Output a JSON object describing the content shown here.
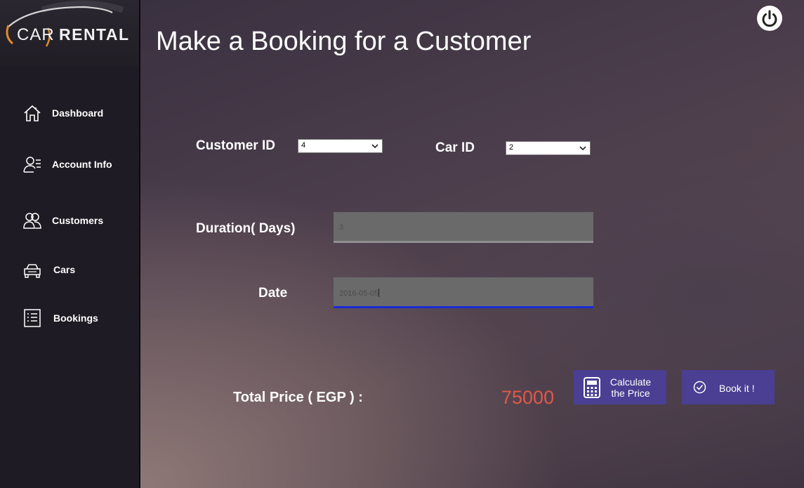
{
  "logo": {
    "car": "CAR",
    "rental": "RENTAL"
  },
  "sidebar": {
    "items": [
      {
        "label": "Dashboard",
        "icon": "home-icon"
      },
      {
        "label": "Account Info",
        "icon": "account-icon"
      },
      {
        "label": "Customers",
        "icon": "users-icon"
      },
      {
        "label": "Cars",
        "icon": "car-icon"
      },
      {
        "label": "Bookings",
        "icon": "list-icon"
      }
    ]
  },
  "main": {
    "title": "Make a Booking for a Customer",
    "power_icon": "power-icon",
    "customer_id": {
      "label": "Customer ID",
      "value": "4"
    },
    "car_id": {
      "label": "Car ID",
      "value": "2"
    },
    "duration": {
      "label": "Duration( Days)",
      "value": "3"
    },
    "date": {
      "label": "Date",
      "value": "2016-05-05"
    },
    "total": {
      "label": "Total Price ( EGP ) :",
      "value": "75000"
    },
    "calc_button": {
      "line1": "Calculate",
      "line2": "the Price",
      "icon": "calculator-icon"
    },
    "book_button": {
      "label": "Book it !",
      "icon": "check-circle-icon"
    }
  },
  "colors": {
    "sidebar_bg": "#1f1b24",
    "button_bg": "#4a3f92",
    "price": "#e0584a",
    "focus_underline": "#1a2bd6"
  }
}
